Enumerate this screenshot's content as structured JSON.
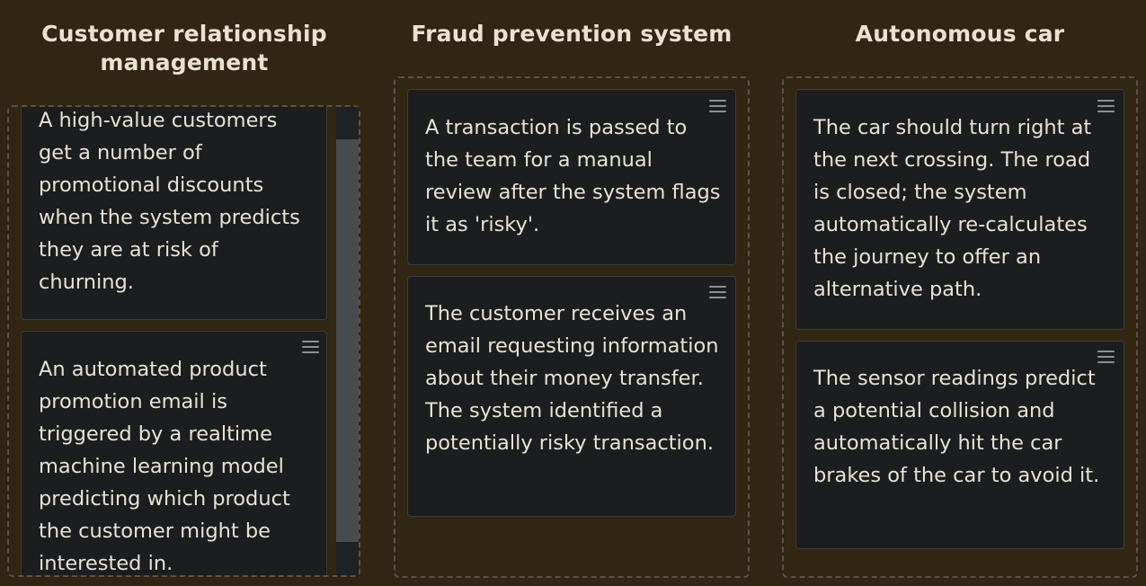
{
  "columns": [
    {
      "title": "Customer relationship management",
      "cards": [
        {
          "text": "A high-value customers get a number of promotional discounts when the system predicts they are at risk of churning."
        },
        {
          "text": "An automated product promotion email is triggered by a realtime machine learning model predicting which product the customer might be interested in."
        }
      ]
    },
    {
      "title": "Fraud prevention system",
      "cards": [
        {
          "text": "A transaction is passed to the team for a manual review after the system flags it as 'risky'."
        },
        {
          "text": "The customer receives an email requesting information about their money transfer. The system identified a potentially risky transaction."
        }
      ]
    },
    {
      "title": "Autonomous car",
      "cards": [
        {
          "text": "The car should turn right at the next crossing. The road is closed; the system automatically re-calculates the journey to offer an alternative path."
        },
        {
          "text": "The sensor readings predict a potential collision and automatically hit the car brakes of the car to avoid it."
        }
      ]
    }
  ],
  "colors": {
    "background": "#302611",
    "card": "#1c1d1f",
    "text": "#e6e2d6",
    "title": "#e9e2cf",
    "dashed_border": "#5b5245"
  },
  "icons": {
    "drag_handle": "hamburger-icon"
  }
}
